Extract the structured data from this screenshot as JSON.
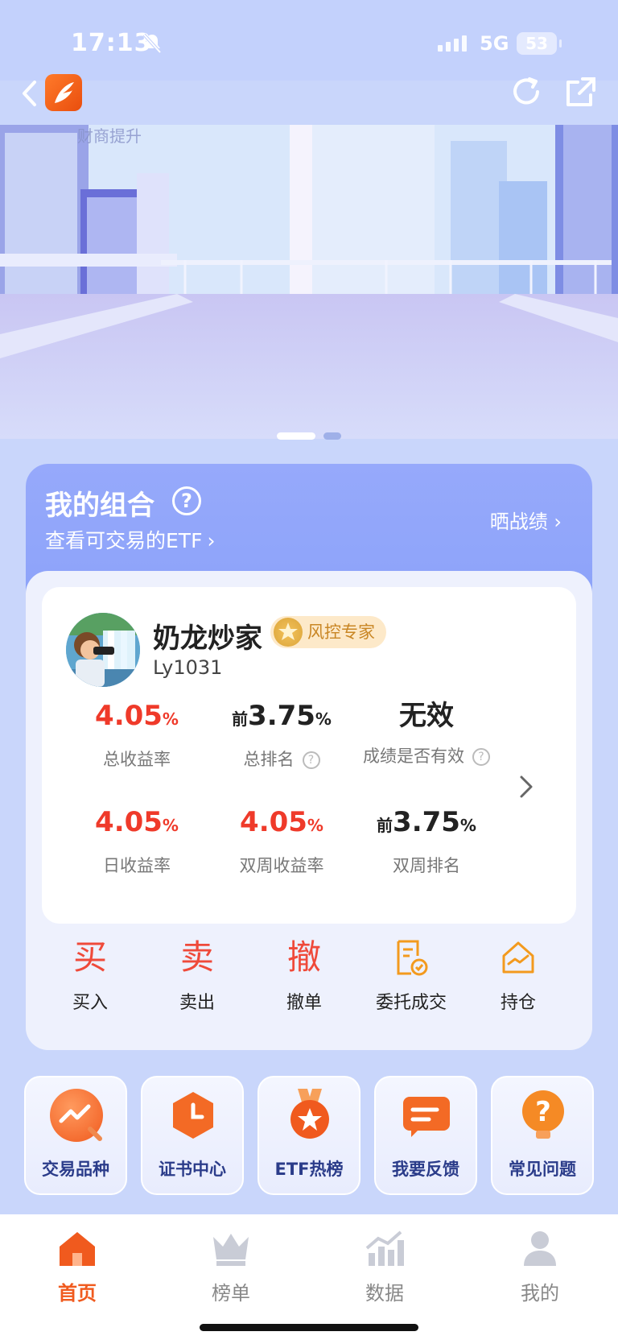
{
  "status_bar": {
    "time": "17:13",
    "network": "5G",
    "battery": "53"
  },
  "banner": {
    "text": "财商提升",
    "dot_count": 2,
    "active_index": 0
  },
  "portfolio": {
    "title": "我的组合",
    "subtitle": "查看可交易的ETF",
    "show_link": "晒战绩",
    "user": {
      "name": "奶龙炒家",
      "badge": "风控专家",
      "id": "Ly1031"
    },
    "stats": [
      {
        "value": "4.05",
        "unit": "%",
        "prefix": "",
        "label": "总收益率",
        "color": "red"
      },
      {
        "value": "3.75",
        "unit": "%",
        "prefix": "前",
        "label": "总排名",
        "color": "dark",
        "help": true
      },
      {
        "value": "无效",
        "unit": "",
        "prefix": "",
        "label": "成绩是否有效",
        "color": "dark",
        "help": true
      },
      {
        "value": "4.05",
        "unit": "%",
        "prefix": "",
        "label": "日收益率",
        "color": "red"
      },
      {
        "value": "4.05",
        "unit": "%",
        "prefix": "",
        "label": "双周收益率",
        "color": "red"
      },
      {
        "value": "3.75",
        "unit": "%",
        "prefix": "前",
        "label": "双周排名",
        "color": "dark"
      }
    ],
    "actions": [
      {
        "icon": "买",
        "label": "买入"
      },
      {
        "icon": "卖",
        "label": "卖出"
      },
      {
        "icon": "撤",
        "label": "撤单"
      },
      {
        "icon": "委托",
        "label": "委托成交"
      },
      {
        "icon": "持仓",
        "label": "持仓"
      }
    ]
  },
  "tiles": [
    {
      "label": "交易品种",
      "icon": "trend-search-icon"
    },
    {
      "label": "证书中心",
      "icon": "clock-hex-icon"
    },
    {
      "label": "ETF热榜",
      "icon": "medal-star-icon"
    },
    {
      "label": "我要反馈",
      "icon": "message-icon"
    },
    {
      "label": "常见问题",
      "icon": "question-bulb-icon"
    }
  ],
  "tabbar": [
    {
      "label": "首页",
      "active": true
    },
    {
      "label": "榜单",
      "active": false
    },
    {
      "label": "数据",
      "active": false
    },
    {
      "label": "我的",
      "active": false
    }
  ],
  "colors": {
    "accent": "#f05a1e",
    "red": "#ef3a2a",
    "orange": "#f39a1e",
    "card_header": "#8ea4fa"
  }
}
